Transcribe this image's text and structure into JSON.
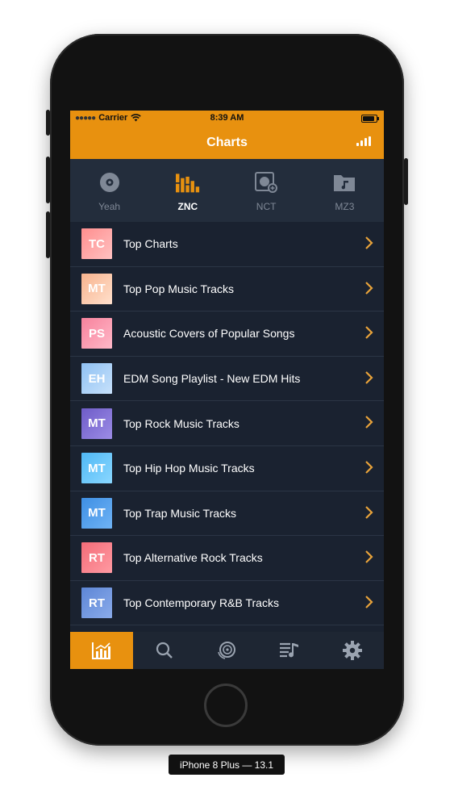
{
  "status_bar": {
    "carrier": "Carrier",
    "time": "8:39 AM"
  },
  "navbar": {
    "title": "Charts",
    "right_icon": "signal-bars-icon"
  },
  "sources": [
    {
      "label": "Yeah",
      "icon": "disc-icon",
      "active": false
    },
    {
      "label": "ZNC",
      "icon": "equalizer-icon",
      "active": true
    },
    {
      "label": "NCT",
      "icon": "music-box-icon",
      "active": false
    },
    {
      "label": "MZ3",
      "icon": "music-folder-icon",
      "active": false
    }
  ],
  "charts": [
    {
      "badge": "TC",
      "label": "Top Charts",
      "colors": [
        "#ff8e8e",
        "#ffc1c1"
      ]
    },
    {
      "badge": "MT",
      "label": "Top Pop Music Tracks",
      "colors": [
        "#f8b38e",
        "#ffe0cc"
      ]
    },
    {
      "badge": "PS",
      "label": "Acoustic Covers of Popular Songs",
      "colors": [
        "#f7829c",
        "#ffb8c8"
      ]
    },
    {
      "badge": "EH",
      "label": "EDM Song Playlist - New EDM Hits",
      "colors": [
        "#8fc1f3",
        "#c7e1fb"
      ]
    },
    {
      "badge": "MT",
      "label": "Top Rock Music Tracks",
      "colors": [
        "#6e5cc8",
        "#9c8ce6"
      ]
    },
    {
      "badge": "MT",
      "label": "Top Hip Hop Music Tracks",
      "colors": [
        "#4fb8f5",
        "#8ad7ff"
      ]
    },
    {
      "badge": "MT",
      "label": "Top Trap Music Tracks",
      "colors": [
        "#3e8fe4",
        "#6fb3f5"
      ]
    },
    {
      "badge": "RT",
      "label": "Top Alternative Rock Tracks",
      "colors": [
        "#f36c78",
        "#ff9aa2"
      ]
    },
    {
      "badge": "RT",
      "label": "Top Contemporary R&B Tracks",
      "colors": [
        "#5d86d6",
        "#8aabea"
      ]
    }
  ],
  "tabs": [
    {
      "icon": "chart-icon",
      "active": true
    },
    {
      "icon": "search-icon",
      "active": false
    },
    {
      "icon": "disc-icon",
      "active": false
    },
    {
      "icon": "playlist-icon",
      "active": false
    },
    {
      "icon": "gear-icon",
      "active": false
    }
  ],
  "colors": {
    "accent": "#e8910f",
    "background": "#1a2230",
    "chevron": "#e8a33a"
  },
  "device": {
    "label": "iPhone 8 Plus — 13.1"
  }
}
